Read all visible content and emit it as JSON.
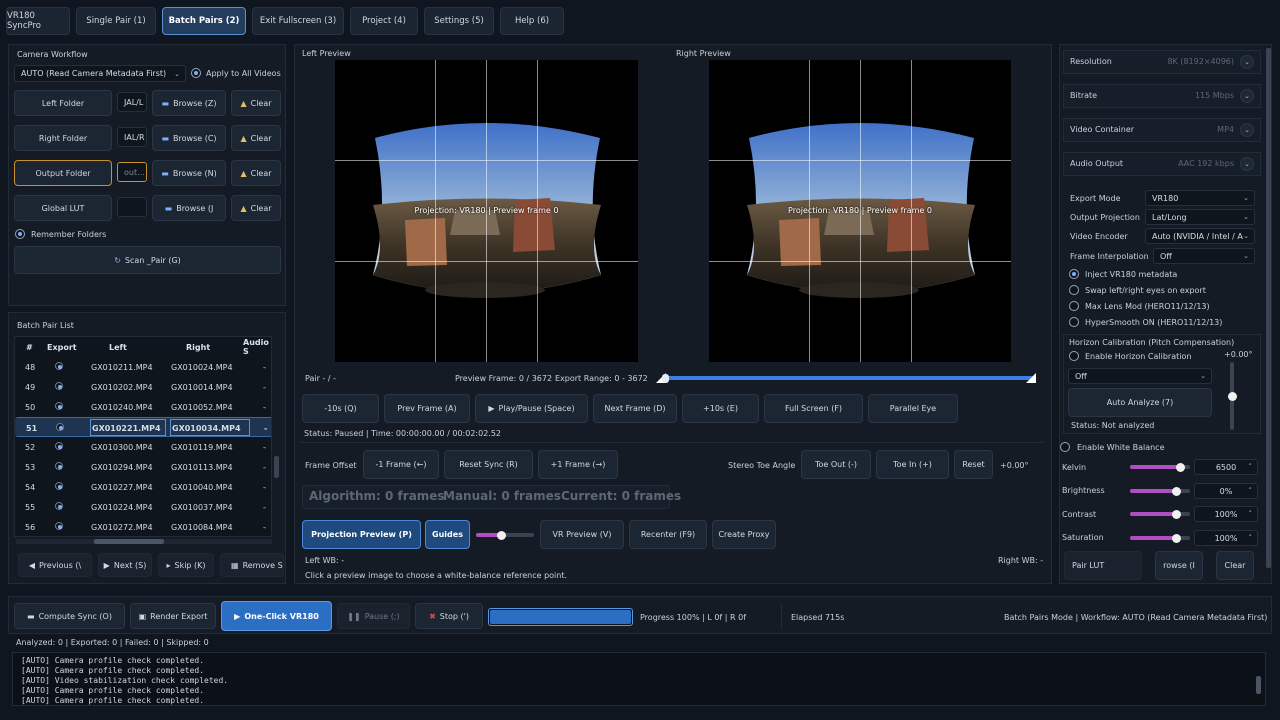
{
  "tabs": [
    {
      "label": "VR180 SyncPro"
    },
    {
      "label": "Single Pair (1)"
    },
    {
      "label": "Batch Pairs (2)"
    },
    {
      "label": "Exit Fullscreen (3)"
    },
    {
      "label": "Project (4)"
    },
    {
      "label": "Settings (5)"
    },
    {
      "label": "Help (6)"
    }
  ],
  "left": {
    "workflow_title": "Camera Workflow",
    "workflow_value": "AUTO (Read Camera Metadata First)",
    "apply_all": "Apply to All Videos",
    "left_folder": "Left Folder",
    "left_folder_value": "JAL/L",
    "right_folder": "Right Folder",
    "right_folder_value": "IAL/R",
    "output_folder": "Output Folder",
    "output_folder_value": "out...",
    "global_lut": "Global LUT",
    "browse_z": "Browse (Z)",
    "browse_c": "Browse (C)",
    "browse_n": "Browse (N)",
    "browse_j": "Browse (J",
    "clear": "Clear",
    "remember": "Remember Folders",
    "scan": "Scan _Pair (G)",
    "batch_title": "Batch Pair List",
    "columns": [
      "#",
      "Export",
      "Left",
      "Right",
      "Audio S"
    ],
    "rows": [
      {
        "num": "48",
        "left": "GX010211.MP4",
        "right": "GX010024.MP4",
        "audio": "-"
      },
      {
        "num": "49",
        "left": "GX010202.MP4",
        "right": "GX010014.MP4",
        "audio": "-"
      },
      {
        "num": "50",
        "left": "GX010240.MP4",
        "right": "GX010052.MP4",
        "audio": "-"
      },
      {
        "num": "51",
        "left": "GX010221.MP4",
        "right": "GX010034.MP4",
        "audio": "-"
      },
      {
        "num": "52",
        "left": "GX010300.MP4",
        "right": "GX010119.MP4",
        "audio": "-"
      },
      {
        "num": "53",
        "left": "GX010294.MP4",
        "right": "GX010113.MP4",
        "audio": "-"
      },
      {
        "num": "54",
        "left": "GX010227.MP4",
        "right": "GX010040.MP4",
        "audio": "-"
      },
      {
        "num": "55",
        "left": "GX010224.MP4",
        "right": "GX010037.MP4",
        "audio": "-"
      },
      {
        "num": "56",
        "left": "GX010272.MP4",
        "right": "GX010084.MP4",
        "audio": "-"
      }
    ],
    "previous": "Previous (\\",
    "next": "Next (S)",
    "skip": "Skip (K)",
    "remove": "Remove Se"
  },
  "center": {
    "left_preview": "Left Preview",
    "right_preview": "Right Preview",
    "overlay_left": "Projection: VR180 | Preview frame 0",
    "overlay_right": "Projection: VR180 | Preview frame 0",
    "pair": "Pair - / -",
    "preview_frame": "Preview Frame: 0 / 3672",
    "export_range": "Export Range: 0 - 3672",
    "nav": [
      "-10s (Q)",
      "Prev Frame (A)",
      "Play/Pause (Space)",
      "Next Frame (D)",
      "+10s (E)",
      "Full Screen (F)",
      "Parallel Eye"
    ],
    "status": "Status: Paused | Time: 00:00:00.00 / 00:02:02.52",
    "frame_offset": "Frame Offset",
    "minus1": "-1 Frame (←)",
    "reset_sync": "Reset Sync (R)",
    "plus1": "+1 Frame (→)",
    "toe_angle": "Stereo Toe Angle",
    "toe_out": "Toe Out (-)",
    "toe_in": "Toe In (+)",
    "reset": "Reset",
    "toe_value": "+0.00°",
    "algorithm": "Algorithm: 0 frames",
    "manual": "Manual: 0 frames",
    "current": "Current: 0 frames",
    "projection_preview": "Projection Preview (P)",
    "guides": "Guides",
    "vr_preview": "VR Preview (V)",
    "recenter": "Recenter (F9)",
    "create_proxy": "Create Proxy",
    "left_wb": "Left WB: -",
    "right_wb": "Right WB: -",
    "wb_hint": "Click a preview image to choose a white-balance reference point."
  },
  "right": {
    "resolution": "Resolution",
    "resolution_value": "8K (8192×4096)",
    "bitrate": "Bitrate",
    "bitrate_value": "115 Mbps",
    "container": "Video Container",
    "container_value": "MP4",
    "audio": "Audio Output",
    "audio_value": "AAC 192 kbps",
    "export_mode": "Export Mode",
    "export_mode_value": "VR180",
    "out_proj": "Output Projection",
    "out_proj_value": "Lat/Long",
    "encoder": "Video Encoder",
    "encoder_value": "Auto (NVIDIA / Intel / A",
    "interp": "Frame Interpolation",
    "interp_value": "Off",
    "inject": "Inject VR180 metadata",
    "swap": "Swap left/right eyes on export",
    "maxlens": "Max Lens Mod (HERO11/12/13)",
    "hypersmooth": "HyperSmooth ON (HERO11/12/13)",
    "horizon_title": "Horizon Calibration (Pitch Compensation)",
    "enable_horizon": "Enable Horizon Calibration",
    "horizon_value": "+0.00°",
    "horizon_mode": "Off",
    "auto_analyze": "Auto Analyze (7)",
    "horizon_status": "Status: Not analyzed",
    "enable_wb": "Enable White Balance",
    "kelvin": "Kelvin",
    "kelvin_value": "6500",
    "brightness": "Brightness",
    "brightness_value": "0%",
    "contrast": "Contrast",
    "contrast_value": "100%",
    "saturation": "Saturation",
    "saturation_value": "100%",
    "pair_lut": "Pair LUT",
    "browse": "rowse (I",
    "clear": "Clear"
  },
  "bottom": {
    "compute": "Compute Sync (O)",
    "render": "Render Export",
    "oneclick": "One-Click VR180",
    "pause": "Pause (;)",
    "stop": "Stop (')",
    "progress_value": 1.0,
    "progress": "Progress 100% | L 0f | R 0f",
    "elapsed": "Elapsed 715s",
    "mode": "Batch Pairs Mode | Workflow: AUTO (Read Camera Metadata First)",
    "counts": "Analyzed: 0 | Exported: 0 | Failed: 0 | Skipped: 0",
    "log": [
      "[AUTO] Camera profile check completed.",
      "[AUTO] Camera profile check completed.",
      "[AUTO] Video stabilization check completed.",
      "[AUTO] Camera profile check completed.",
      "[AUTO] Camera profile check completed."
    ]
  },
  "colors": {
    "accent": "#2b6fc4",
    "slider": "#b04fc4",
    "bg": "#10161f"
  }
}
